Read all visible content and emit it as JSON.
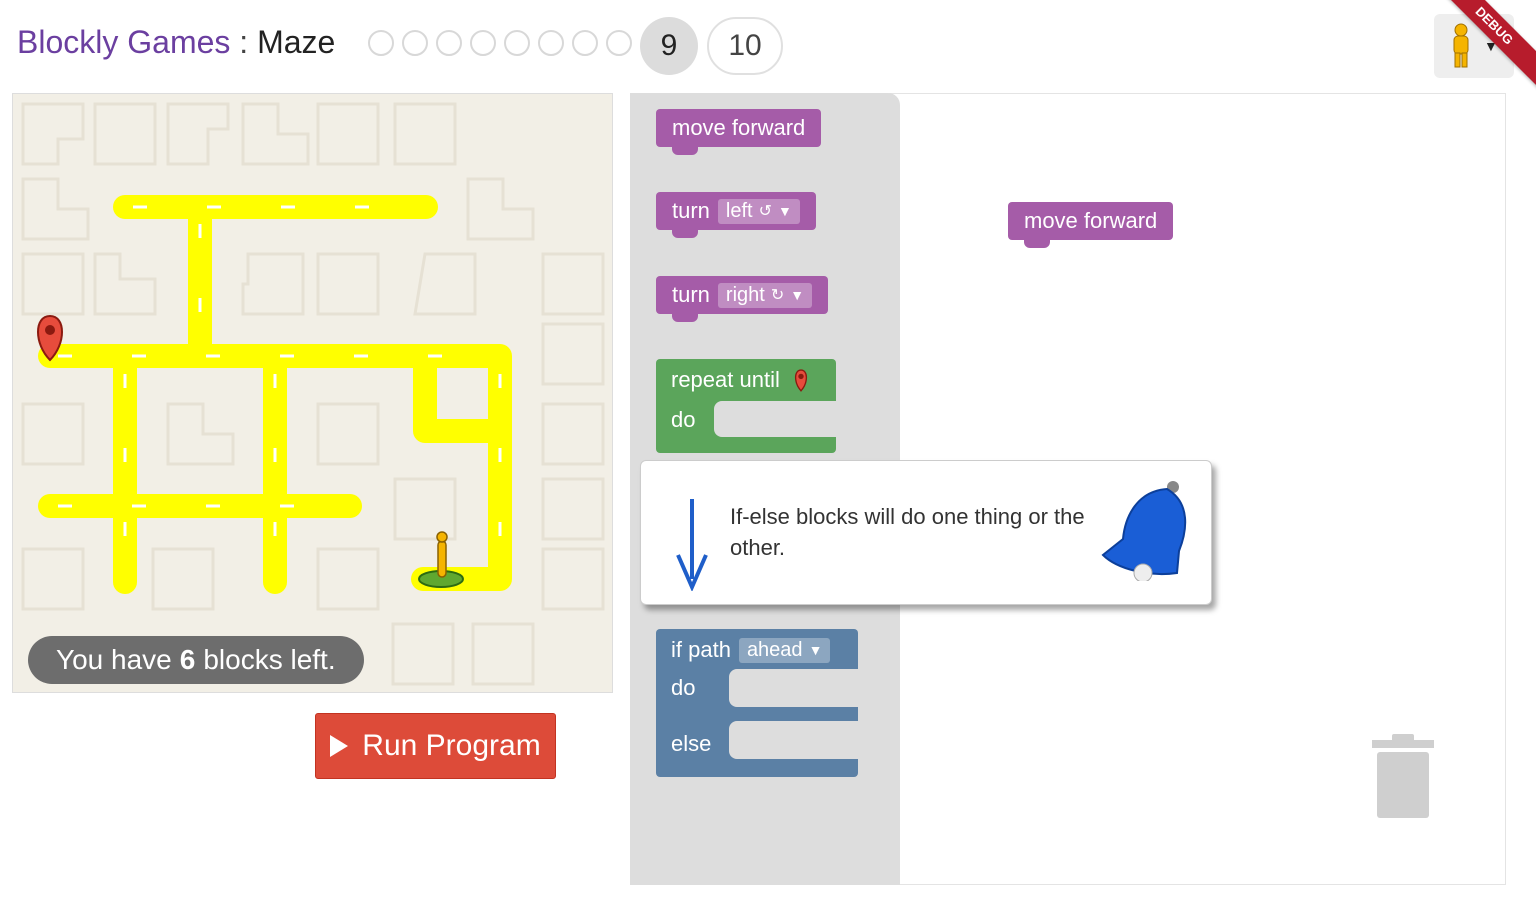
{
  "header": {
    "app_title": "Blockly Games",
    "separator": " : ",
    "level_title": "Maze",
    "levels_done": 8,
    "current_level": "9",
    "next_level": "10",
    "debug_badge": "DEBUG"
  },
  "maze": {
    "capacity_prefix": "You have",
    "capacity_count": "6",
    "capacity_suffix": "blocks left.",
    "path_color": "#ffff00",
    "background_color": "#f2efe6"
  },
  "run_button": {
    "label": "Run Program",
    "color": "#dd4b39"
  },
  "toolbox": {
    "move_forward": "move forward",
    "turn_left_prefix": "turn",
    "turn_left_value": "left",
    "turn_right_prefix": "turn",
    "turn_right_value": "right",
    "repeat_until": "repeat until",
    "repeat_do": "do",
    "if_path": "if path",
    "if_path_value": "ahead",
    "if_do": "do",
    "if_else": "else",
    "rotate_left_glyph": "↺",
    "rotate_right_glyph": "↻",
    "dropdown_glyph": "▼"
  },
  "workspace": {
    "placed_block": "move forward"
  },
  "help": {
    "text": "If-else blocks will do one thing or the other."
  },
  "colors": {
    "motion_purple": "#a55ca8",
    "loop_green": "#5ba55b",
    "logic_blue": "#5b80a5",
    "title_purple": "#6b3fa0"
  },
  "icons": [
    "marker-icon",
    "pegman-icon",
    "bell-icon",
    "arrow-down-icon",
    "trash-icon",
    "play-icon"
  ]
}
